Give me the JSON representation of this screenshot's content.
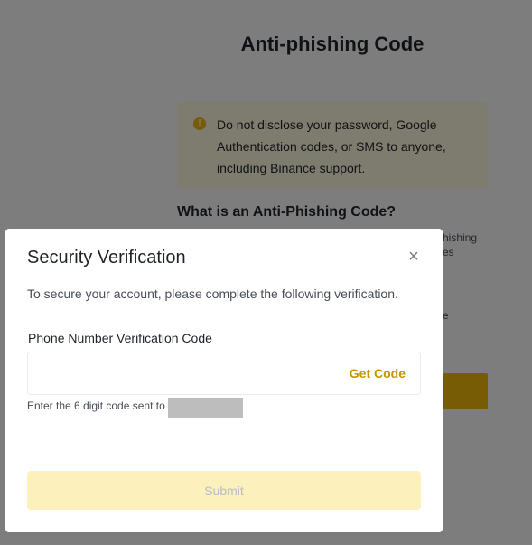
{
  "background": {
    "title": "Anti-phishing Code",
    "warning": "Do not disclose your password, Google Authentication codes, or SMS to anyone, including Binance support.",
    "subheading": "What is an Anti-Phishing Code?",
    "fragments": [
      "hishing",
      "es",
      "e"
    ]
  },
  "modal": {
    "title": "Security Verification",
    "close": "×",
    "description": "To secure your account, please complete the following verification.",
    "field_label": "Phone Number Verification Code",
    "input_value": "",
    "get_code": "Get Code",
    "hint": "Enter the 6 digit code sent to",
    "submit": "Submit"
  },
  "colors": {
    "accent": "#f0b90b",
    "get_code": "#c99400",
    "submit_disabled_bg": "#fcf0bd",
    "overlay": "rgba(0,0,0,0.5)"
  },
  "icons": [
    "warning-icon",
    "close-icon"
  ]
}
